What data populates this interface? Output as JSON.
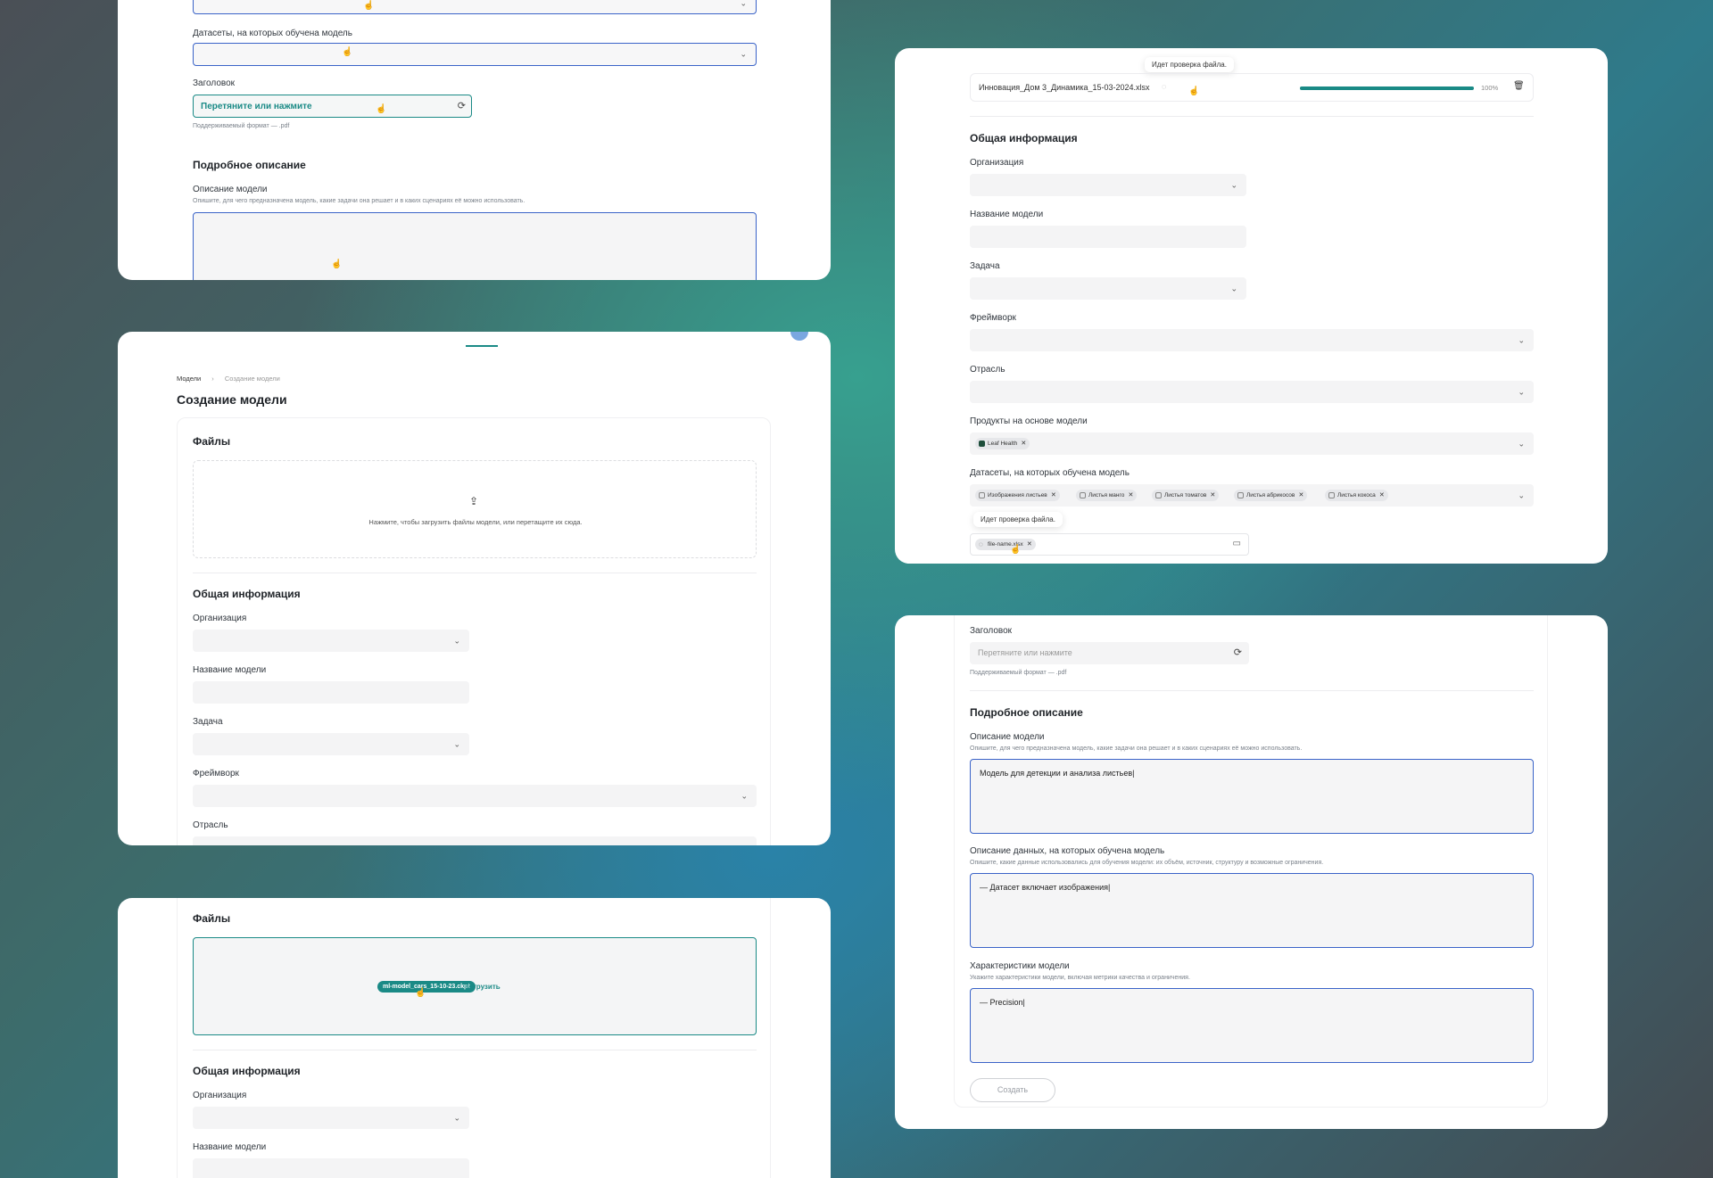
{
  "panel1": {
    "datasets_label": "Датасеты, на которых обучена модель",
    "header_label": "Заголовок",
    "drop_label": "Перетяните или нажмите",
    "format_hint": "Поддерживаемый формат — .pdf",
    "detail_title": "Подробное описание",
    "model_desc_label": "Описание модели",
    "model_desc_hint": "Опишите, для чего предназначена модель, какие задачи она решает и в каких сценариях её можно использовать."
  },
  "panel2": {
    "breadcrumb_root": "Модели",
    "breadcrumb_sep": "›",
    "breadcrumb_current": "Создание модели",
    "page_title": "Создание модели",
    "files_title": "Файлы",
    "upload_text": "Нажмите, чтобы загрузить файлы модели, или перетащите их сюда.",
    "general_title": "Общая информация",
    "org_label": "Организация",
    "name_label": "Название модели",
    "task_label": "Задача",
    "framework_label": "Фреймворк",
    "industry_label": "Отрасль"
  },
  "panel3": {
    "files_title": "Файлы",
    "drag_file": "ml-model_cars_15-10-23.ckpt",
    "upload_link": "Загрузить",
    "general_title": "Общая информация",
    "org_label": "Организация",
    "name_label": "Название модели"
  },
  "panel4": {
    "tooltip_top": "Идет проверка файла.",
    "file_name": "Инновация_Дом 3_Динамика_15-03-2024.xlsx",
    "progress_value": 100,
    "progress_text": "100%",
    "general_title": "Общая информация",
    "org_label": "Организация",
    "name_label": "Название модели",
    "task_label": "Задача",
    "framework_label": "Фреймворк",
    "industry_label": "Отрасль",
    "products_label": "Продукты на основе модели",
    "product_tag": "Leaf Health",
    "datasets_label": "Датасеты, на которых обучена модель",
    "dataset_tags": [
      "Изображения листьев",
      "Листья манго",
      "Листья томатов",
      "Листья абрикосов",
      "Листья кокоса"
    ],
    "tooltip_bottom": "Идет проверка файла.",
    "file_tag": "file-name.xlsx"
  },
  "panel5": {
    "header_label": "Заголовок",
    "drop_placeholder": "Перетяните или нажмите",
    "format_hint": "Поддерживаемый формат — .pdf",
    "detail_title": "Подробное описание",
    "model_desc_label": "Описание модели",
    "model_desc_hint": "Опишите, для чего предназначена модель, какие задачи она решает и в каких сценариях её можно использовать.",
    "model_desc_value": "Модель для детекции и анализа листьев|",
    "data_desc_label": "Описание данных, на которых обучена модель",
    "data_desc_hint": "Опишите, какие данные использовались для обучения модели: их объём, источник, структуру и возможные ограничения.",
    "data_desc_value": "— Датасет включает изображения|",
    "chars_label": "Характеристики модели",
    "chars_hint": "Укажите характеристики модели, включая метрики качества и ограничения.",
    "chars_value": "— Precision|",
    "create_button": "Создать"
  },
  "colors": {
    "accent": "#1a8a86",
    "focus_border": "#3a63c8",
    "field_bg": "#f4f4f5"
  }
}
